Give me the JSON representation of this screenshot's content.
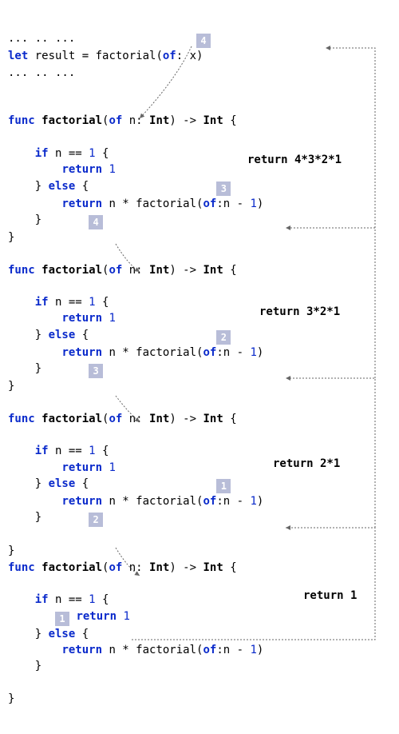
{
  "intro": {
    "dots1": "... .. ...",
    "line": "let result = factorial(of: x)",
    "dots2": "... .. ..."
  },
  "block1": {
    "sig": "func factorial(of n: Int) -> Int {",
    "ifline": "    if n == 1 {",
    "ret1": "        return 1",
    "elseline": "    } else {",
    "ret2": "        return n * factorial(of:n - 1)",
    "close1": "    }",
    "close2": "}",
    "return_label": "return 4*3*2*1",
    "badge_top": "4",
    "arg_badge": "3",
    "n_badge": "4"
  },
  "block2": {
    "sig": "func factorial(of n: Int) -> Int {",
    "ifline": "    if n == 1 {",
    "ret1": "        return 1",
    "elseline": "    } else {",
    "ret2": "        return n * factorial(of:n - 1)",
    "close1": "    }",
    "close2": "}",
    "return_label": "return 3*2*1",
    "arg_badge": "2",
    "n_badge": "3"
  },
  "block3": {
    "sig": "func factorial(of n: Int) -> Int {",
    "ifline": "    if n == 1 {",
    "ret1": "        return 1",
    "elseline": "    } else {",
    "ret2": "        return n * factorial(of:n - 1)",
    "close1": "    }",
    "close2": "}",
    "return_label": "return 2*1",
    "arg_badge": "1",
    "n_badge": "2"
  },
  "block4": {
    "sig": "func factorial(of n: Int) -> Int {",
    "ifline": "    if n == 1 {",
    "ret1": "        return 1",
    "elseline": "    } else {",
    "ret2": "        return n * factorial(of:n - 1)",
    "close1": "    }",
    "close2": "}",
    "return_label": "return 1",
    "ret1_badge": "1"
  }
}
